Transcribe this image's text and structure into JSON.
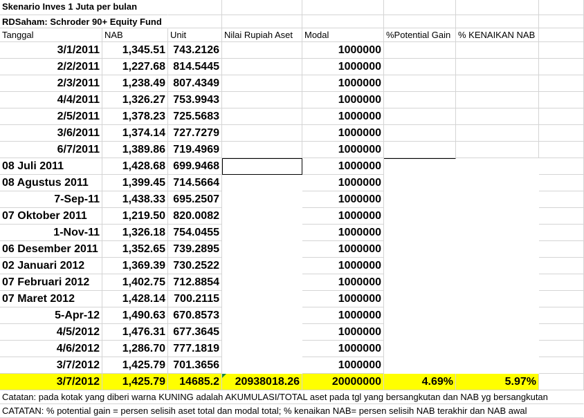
{
  "title1": "Skenario Inves 1 Juta per bulan",
  "title2": "RDSaham: Schroder 90+ Equity Fund",
  "headers": {
    "tanggal": "Tanggal",
    "nab": "NAB",
    "unit": "Unit",
    "nilai": "Nilai Rupiah Aset",
    "modal": "Modal",
    "gain": "%Potential Gain",
    "kenaikan": "% KENAIKAN NAB"
  },
  "rows": [
    {
      "date": "3/1/2011",
      "nab": "1,345.51",
      "unit": "743.2126",
      "modal": "1000000",
      "align": "right"
    },
    {
      "date": "2/2/2011",
      "nab": "1,227.68",
      "unit": "814.5445",
      "modal": "1000000",
      "align": "right"
    },
    {
      "date": "2/3/2011",
      "nab": "1,238.49",
      "unit": "807.4349",
      "modal": "1000000",
      "align": "right"
    },
    {
      "date": "4/4/2011",
      "nab": "1,326.27",
      "unit": "753.9943",
      "modal": "1000000",
      "align": "right"
    },
    {
      "date": "2/5/2011",
      "nab": "1,378.23",
      "unit": "725.5683",
      "modal": "1000000",
      "align": "right"
    },
    {
      "date": "3/6/2011",
      "nab": "1,374.14",
      "unit": "727.7279",
      "modal": "1000000",
      "align": "right"
    },
    {
      "date": "6/7/2011",
      "nab": "1,389.86",
      "unit": "719.4969",
      "modal": "1000000",
      "align": "right"
    },
    {
      "date": "08 Juli 2011",
      "nab": "1,428.68",
      "unit": "699.9468",
      "modal": "1000000",
      "align": "left"
    },
    {
      "date": "08 Agustus 2011",
      "nab": "1,399.45",
      "unit": "714.5664",
      "modal": "1000000",
      "align": "left"
    },
    {
      "date": "7-Sep-11",
      "nab": "1,438.33",
      "unit": "695.2507",
      "modal": "1000000",
      "align": "right"
    },
    {
      "date": "07 Oktober 2011",
      "nab": "1,219.50",
      "unit": "820.0082",
      "modal": "1000000",
      "align": "left"
    },
    {
      "date": "1-Nov-11",
      "nab": "1,326.18",
      "unit": "754.0455",
      "modal": "1000000",
      "align": "right"
    },
    {
      "date": "06 Desember 2011",
      "nab": "1,352.65",
      "unit": "739.2895",
      "modal": "1000000",
      "align": "left"
    },
    {
      "date": "02 Januari 2012",
      "nab": "1,369.39",
      "unit": "730.2522",
      "modal": "1000000",
      "align": "left"
    },
    {
      "date": "07 Februari 2012",
      "nab": "1,402.75",
      "unit": "712.8854",
      "modal": "1000000",
      "align": "left"
    },
    {
      "date": "07 Maret 2012",
      "nab": "1,428.14",
      "unit": "700.2115",
      "modal": "1000000",
      "align": "left"
    },
    {
      "date": "5-Apr-12",
      "nab": "1,490.63",
      "unit": "670.8573",
      "modal": "1000000",
      "align": "right"
    },
    {
      "date": "4/5/2012",
      "nab": "1,476.31",
      "unit": "677.3645",
      "modal": "1000000",
      "align": "right"
    },
    {
      "date": "4/6/2012",
      "nab": "1,286.70",
      "unit": "777.1819",
      "modal": "1000000",
      "align": "right"
    },
    {
      "date": "3/7/2012",
      "nab": "1,425.79",
      "unit": "701.3656",
      "modal": "1000000",
      "align": "right"
    }
  ],
  "total": {
    "date": "3/7/2012",
    "nab": "1,425.79",
    "unit": "14685.2",
    "nilai": "20938018.26",
    "modal": "20000000",
    "gain": "4.69%",
    "kenaikan": "5.97%"
  },
  "notes": [
    "Catatan: pada kotak yang diberi warna KUNING adalah AKUMULASI/TOTAL aset pada tgl yang bersangkutan dan NAB yg bersangkutan",
    "CATATAN: % potential gain = persen selisih aset total dan modal total; % kenaikan NAB= persen selisih NAB terakhir dan NAB awal"
  ],
  "colors": {
    "highlight": "#ffff00",
    "gridline": "#d4d4d4",
    "marker": "#1e8a3e"
  }
}
